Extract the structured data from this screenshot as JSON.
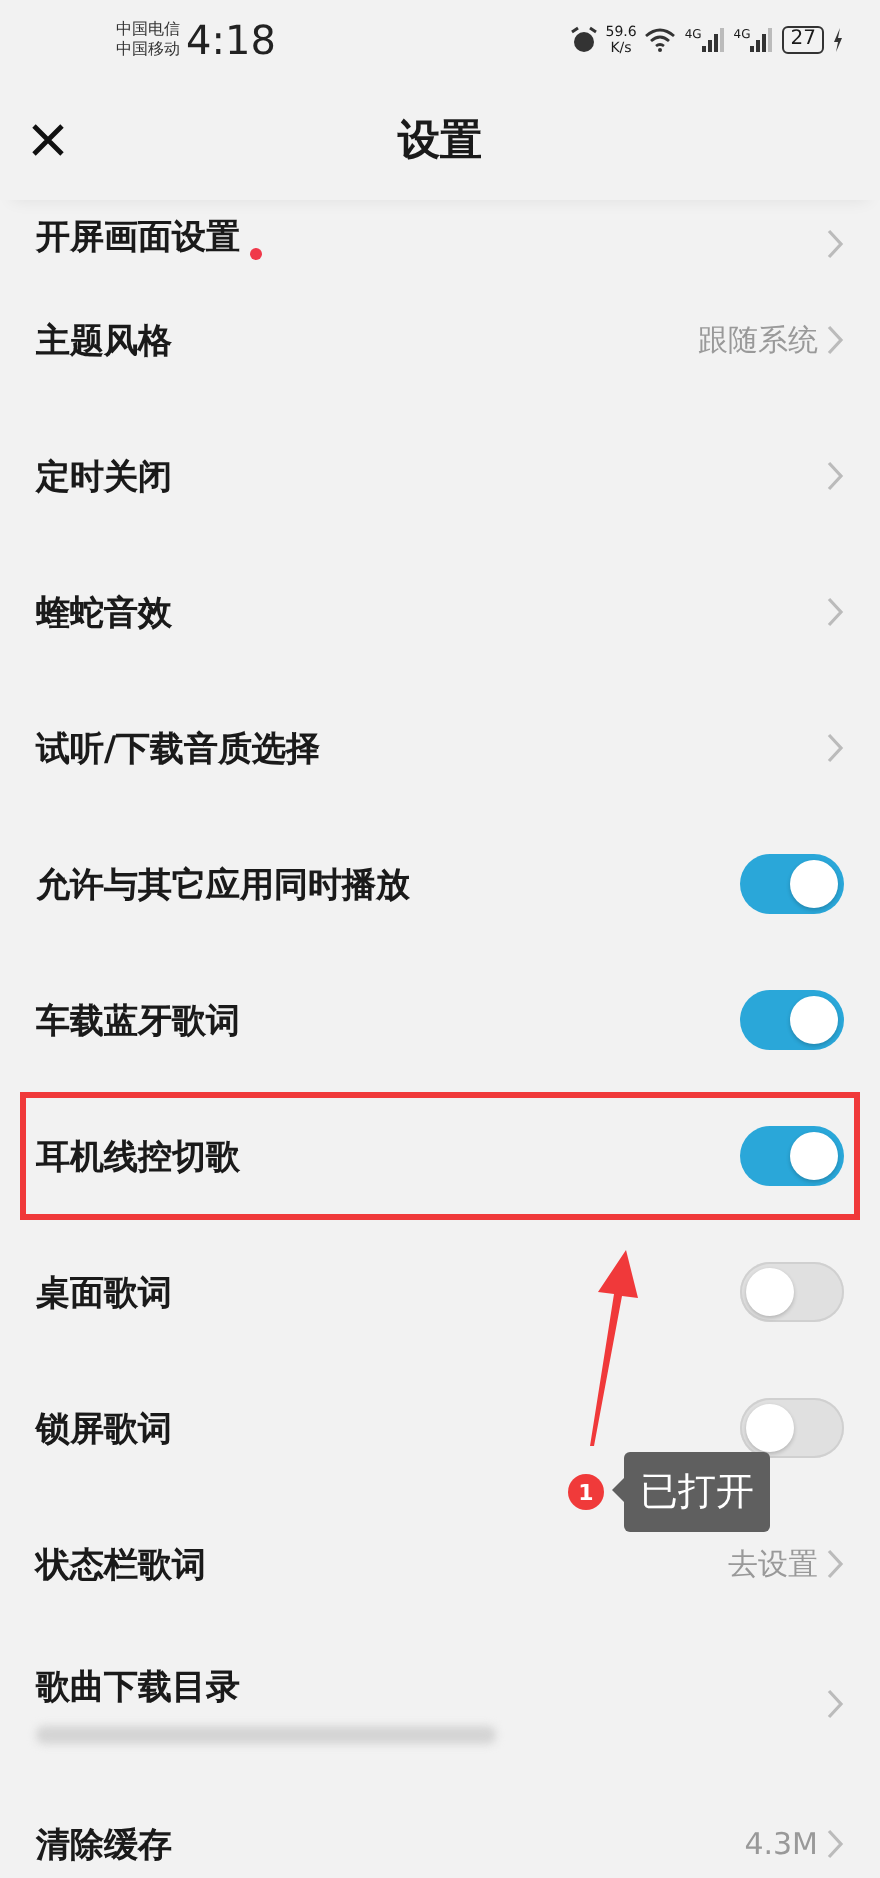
{
  "status_bar": {
    "carriers": [
      "中国电信",
      "中国移动"
    ],
    "time": "4:18",
    "net_speed": "59.6",
    "net_speed_unit": "K/s",
    "signal_labels": [
      "4G",
      "4G"
    ],
    "battery": "27"
  },
  "header": {
    "title": "设置"
  },
  "settings": [
    {
      "label": "开屏画面设置",
      "kind": "link",
      "new_dot": true,
      "highlighted": false
    },
    {
      "label": "主题风格",
      "kind": "value",
      "value": "跟随系统",
      "highlighted": false
    },
    {
      "label": "定时关闭",
      "kind": "link",
      "new_dot": false,
      "highlighted": false
    },
    {
      "label": "蝰蛇音效",
      "kind": "link",
      "new_dot": false,
      "highlighted": false
    },
    {
      "label": "试听/下载音质选择",
      "kind": "link",
      "new_dot": false,
      "highlighted": false
    },
    {
      "label": "允许与其它应用同时播放",
      "kind": "toggle",
      "on": true,
      "highlighted": false
    },
    {
      "label": "车载蓝牙歌词",
      "kind": "toggle",
      "on": true,
      "highlighted": false
    },
    {
      "label": "耳机线控切歌",
      "kind": "toggle",
      "on": true,
      "highlighted": true
    },
    {
      "label": "桌面歌词",
      "kind": "toggle",
      "on": false,
      "highlighted": false
    },
    {
      "label": "锁屏歌词",
      "kind": "toggle",
      "on": false,
      "highlighted": false
    },
    {
      "label": "状态栏歌词",
      "kind": "value",
      "value": "去设置",
      "highlighted": false
    },
    {
      "label": "歌曲下载目录",
      "kind": "path",
      "highlighted": false
    },
    {
      "label": "清除缓存",
      "kind": "value",
      "value": "4.3M",
      "highlighted": false
    }
  ],
  "annotation": {
    "badge": "1",
    "text": "已打开"
  }
}
